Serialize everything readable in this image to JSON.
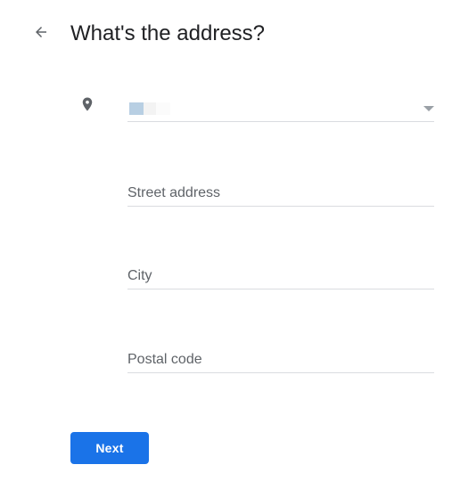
{
  "header": {
    "title": "What's the address?",
    "back_icon": "arrow-left-icon"
  },
  "form": {
    "location_icon": "map-pin-icon",
    "country": {
      "selected": "",
      "dropdown_icon": "caret-down-icon"
    },
    "street": {
      "placeholder": "Street address",
      "value": ""
    },
    "city": {
      "placeholder": "City",
      "value": ""
    },
    "postal": {
      "placeholder": "Postal code",
      "value": ""
    }
  },
  "actions": {
    "next_label": "Next"
  },
  "colors": {
    "primary": "#1a73e8",
    "text": "#202124",
    "placeholder": "#5f6368",
    "divider": "#dadce0",
    "icon": "#5f6368"
  }
}
